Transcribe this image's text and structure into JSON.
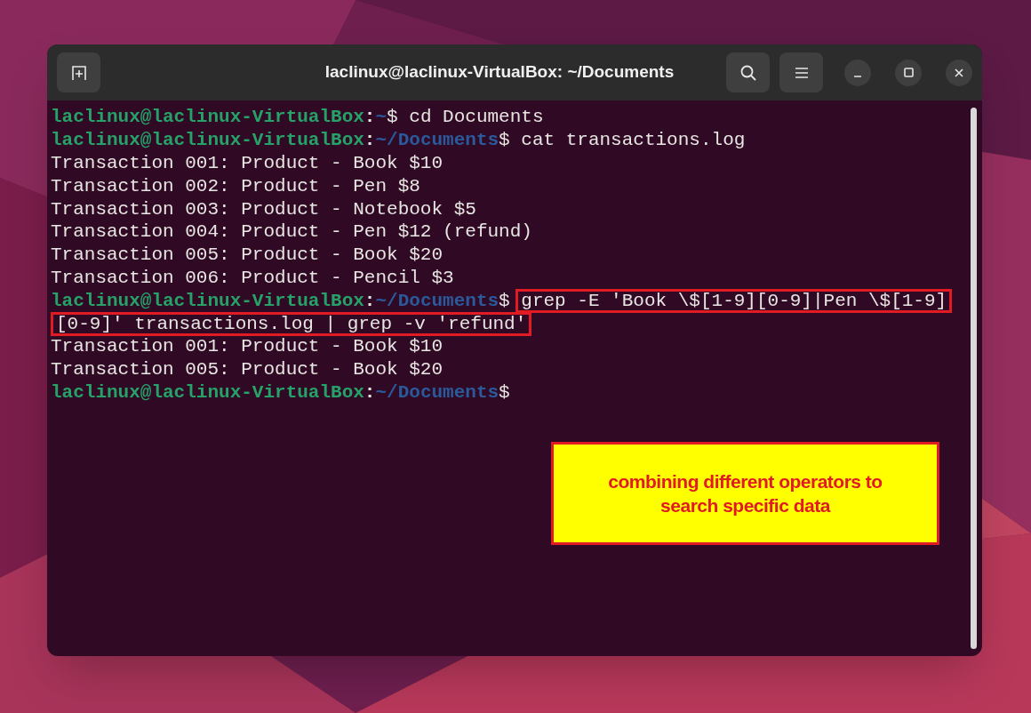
{
  "window": {
    "title": "laclinux@laclinux-VirtualBox: ~/Documents"
  },
  "terminal": {
    "lines": [
      {
        "kind": "prompt",
        "user": "laclinux@laclinux-VirtualBox",
        "colon": ":",
        "path": "~",
        "dollar": "$",
        "command": "cd Documents",
        "highlighted": false
      },
      {
        "kind": "prompt",
        "user": "laclinux@laclinux-VirtualBox",
        "colon": ":",
        "path": "~/Documents",
        "dollar": "$",
        "command": "cat transactions.log",
        "highlighted": false
      },
      {
        "kind": "output",
        "text": "Transaction 001: Product - Book $10"
      },
      {
        "kind": "output",
        "text": "Transaction 002: Product - Pen $8"
      },
      {
        "kind": "output",
        "text": "Transaction 003: Product - Notebook $5"
      },
      {
        "kind": "output",
        "text": "Transaction 004: Product - Pen $12 (refund)"
      },
      {
        "kind": "output",
        "text": "Transaction 005: Product - Book $20"
      },
      {
        "kind": "output",
        "text": "Transaction 006: Product - Pencil $3"
      },
      {
        "kind": "prompt",
        "user": "laclinux@laclinux-VirtualBox",
        "colon": ":",
        "path": "~/Documents",
        "dollar": "$",
        "command": "grep -E 'Book \\$[1-9][0-9]|Pen \\$[1-9]",
        "highlighted": true
      },
      {
        "kind": "continuation",
        "command": "[0-9]' transactions.log | grep -v 'refund'",
        "highlighted": true
      },
      {
        "kind": "output",
        "text": "Transaction 001: Product - Book $10"
      },
      {
        "kind": "output",
        "text": "Transaction 005: Product - Book $20"
      },
      {
        "kind": "prompt",
        "user": "laclinux@laclinux-VirtualBox",
        "colon": ":",
        "path": "~/Documents",
        "dollar": "$"
      }
    ]
  },
  "callout": {
    "text": "combining different operators to search specific data"
  }
}
